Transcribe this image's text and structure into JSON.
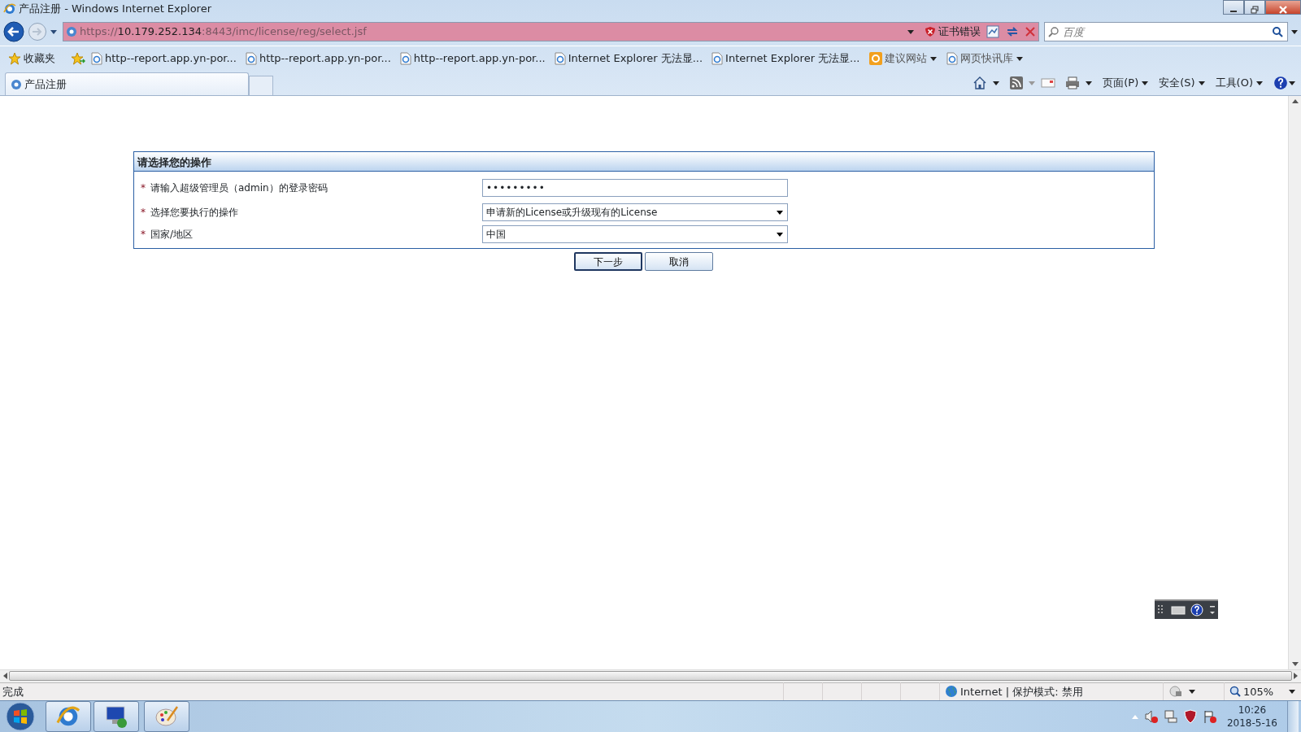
{
  "window": {
    "title": "产品注册 - Windows Internet Explorer"
  },
  "address_bar": {
    "scheme": "https://",
    "host": "10.179.252.134",
    "path": ":8443/imc/license/reg/select.jsf",
    "certificate_error": "证书错误"
  },
  "search": {
    "placeholder": "百度"
  },
  "favorites_bar": {
    "favorites_button": "收藏夹",
    "items": [
      {
        "label": "http--report.app.yn-por...",
        "kind": "page",
        "dropdown": false
      },
      {
        "label": "http--report.app.yn-por...",
        "kind": "page",
        "dropdown": false
      },
      {
        "label": "http--report.app.yn-por...",
        "kind": "page",
        "dropdown": false
      },
      {
        "label": "Internet Explorer 无法显...",
        "kind": "page",
        "dropdown": false
      },
      {
        "label": "Internet Explorer 无法显...",
        "kind": "page",
        "dropdown": false
      },
      {
        "label": "建议网站",
        "kind": "suggested",
        "dropdown": true
      },
      {
        "label": "网页快讯库",
        "kind": "page",
        "dropdown": true
      }
    ]
  },
  "tabs": [
    {
      "label": "产品注册",
      "selected": true
    }
  ],
  "command_bar": {
    "menus": [
      "页面(P)",
      "安全(S)",
      "工具(O)"
    ]
  },
  "form": {
    "title": "请选择您的操作",
    "fields": [
      {
        "kind": "password",
        "marker": "*",
        "label": "请输入超级管理员（admin）的登录密码",
        "value": "•••••••••"
      },
      {
        "kind": "select",
        "marker": "*",
        "label": "选择您要执行的操作",
        "value": "申请新的License或升级现有的License"
      },
      {
        "kind": "select",
        "marker": "*",
        "label": "国家/地区",
        "value": "中国"
      }
    ],
    "buttons": [
      {
        "label": "下一步",
        "default": true
      },
      {
        "label": "取消",
        "default": false
      }
    ]
  },
  "status_bar": {
    "text": "完成",
    "zone": "Internet | 保护模式: 禁用",
    "zoom": "105%"
  },
  "taskbar": {
    "time": "10:26",
    "date": "2018-5-16"
  }
}
